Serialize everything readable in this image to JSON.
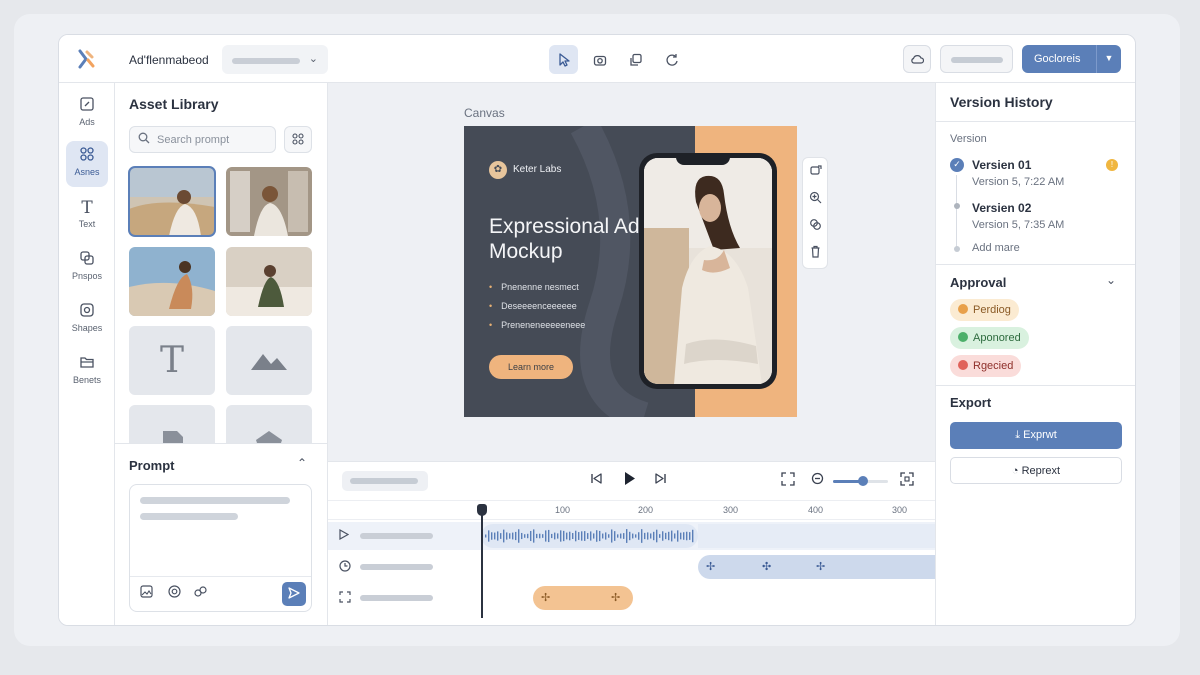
{
  "colors": {
    "accent": "#5b7fb8",
    "accent_light": "#dfe6f3",
    "artboard_dark": "#454b56",
    "artboard_peach": "#efb47e",
    "pending": "#f3c392",
    "approved": "#4caf6a",
    "rejected": "#e0625a"
  },
  "header": {
    "app_name": "Ad'flenmabeod",
    "primary_label": "Gocloreis",
    "tools": [
      "pointer-icon",
      "camera-icon",
      "duplicate-icon",
      "refresh-icon"
    ]
  },
  "rail": {
    "items": [
      {
        "label": "Ads",
        "icon": "ads-icon"
      },
      {
        "label": "Asnes",
        "icon": "assets-grid-icon"
      },
      {
        "label": "Text",
        "icon": "text-icon"
      },
      {
        "label": "Pnspos",
        "icon": "layers-icon"
      },
      {
        "label": "Shapes",
        "icon": "shapes-icon"
      },
      {
        "label": "Benets",
        "icon": "folder-icon"
      }
    ],
    "active_index": 1
  },
  "library": {
    "title": "Asset Library",
    "search_placeholder": "Search prompt"
  },
  "prompt": {
    "title": "Prompt"
  },
  "canvas": {
    "label": "Canvas",
    "artboard": {
      "brand": "Keter Labs",
      "headline": "Expressional Ad Mockup",
      "bullets": [
        "Pnenenne nesmect",
        "Deseeeenceeeeee",
        "Preneneneeeeeneee"
      ],
      "cta": "Learn more"
    }
  },
  "timeline": {
    "ruler_ticks": [
      "100",
      "200",
      "300",
      "400",
      "300"
    ]
  },
  "versions": {
    "title": "Version History",
    "subtitle": "Version",
    "items": [
      {
        "name": "Versien 01",
        "time": "Version 5, 7:22 AM"
      },
      {
        "name": "Versien 02",
        "time": "Version 5, 7:35 AM"
      }
    ],
    "add_more": "Add mare"
  },
  "approval": {
    "title": "Approval",
    "statuses": [
      {
        "label": "Perdiog",
        "state": "pending"
      },
      {
        "label": "Aponored",
        "state": "approved"
      },
      {
        "label": "Rgecied",
        "state": "rejected"
      }
    ]
  },
  "export": {
    "title": "Export",
    "export_label": "Exprwt",
    "report_label": "Reprext"
  }
}
